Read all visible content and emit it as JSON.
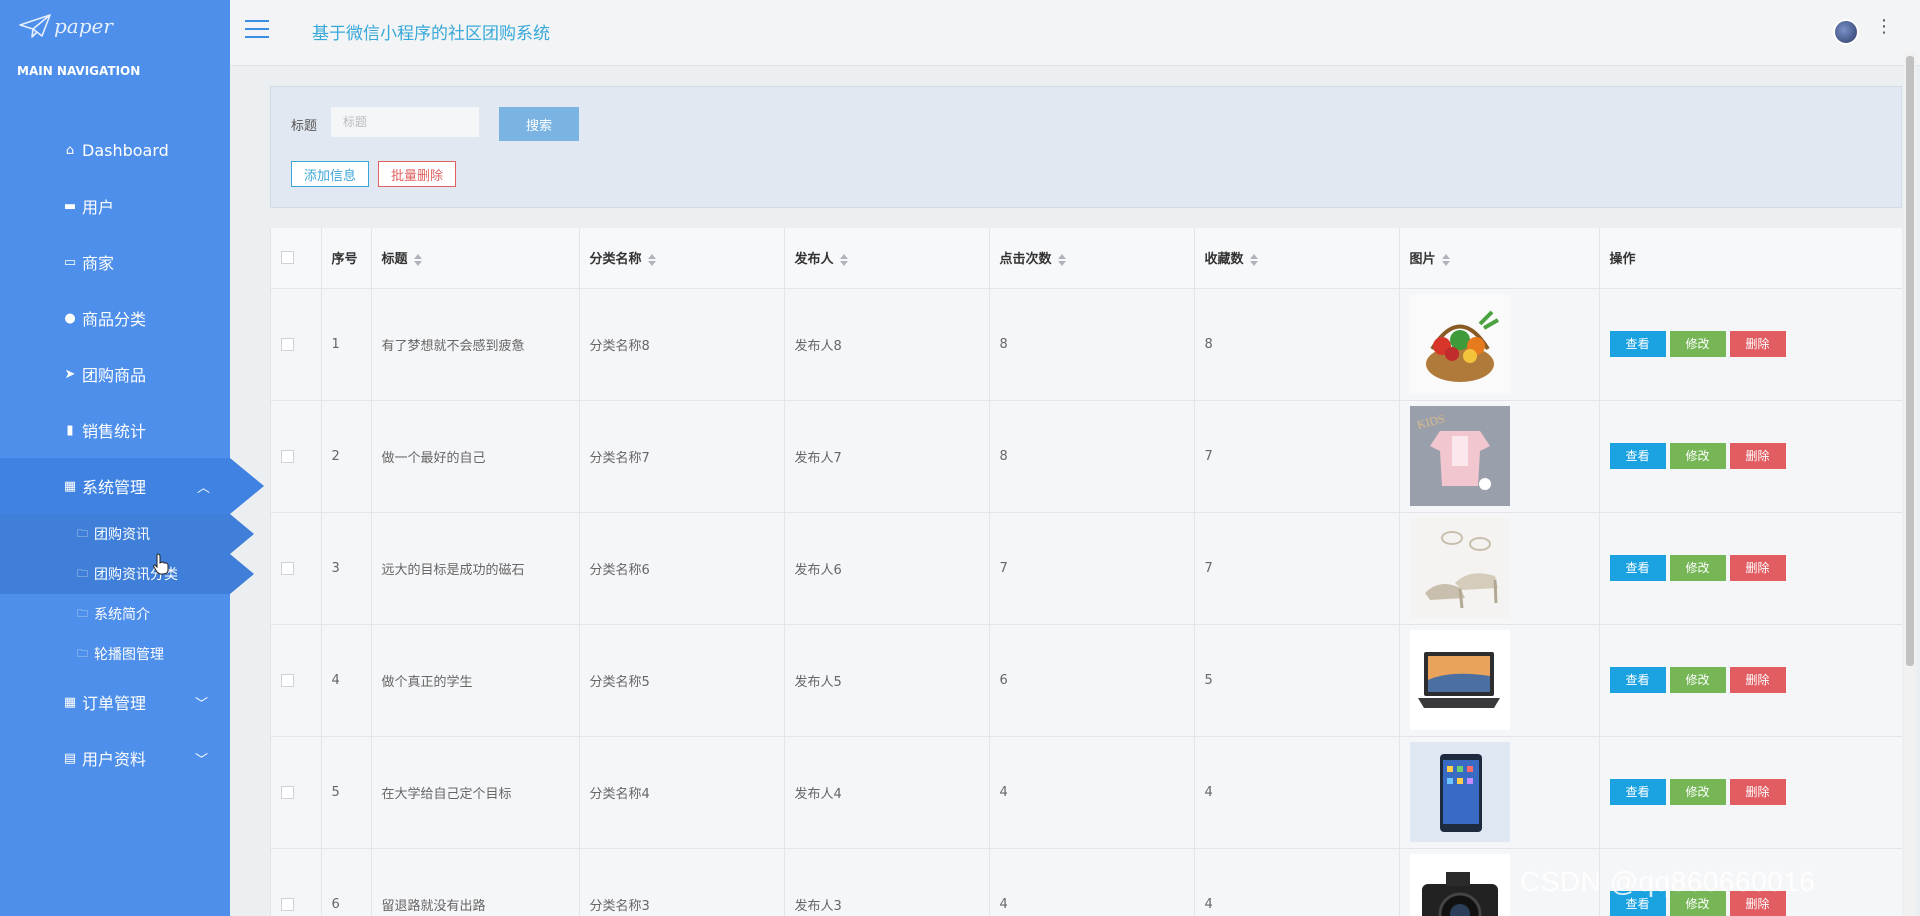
{
  "brand": {
    "logo_text": "paper"
  },
  "sidebar": {
    "section_title": "MAIN NAVIGATION",
    "items": [
      {
        "label": "Dashboard",
        "icon": "home-icon"
      },
      {
        "label": "用户",
        "icon": "briefcase-icon"
      },
      {
        "label": "商家",
        "icon": "id-card-icon"
      },
      {
        "label": "商品分类",
        "icon": "user-icon"
      },
      {
        "label": "团购商品",
        "icon": "paper-plane-icon"
      },
      {
        "label": "销售统计",
        "icon": "clipboard-icon"
      },
      {
        "label": "系统管理",
        "icon": "grid-icon",
        "expanded": true
      },
      {
        "label": "订单管理",
        "icon": "grid-icon"
      },
      {
        "label": "用户资料",
        "icon": "browser-icon"
      }
    ],
    "sub_items": [
      {
        "label": "团购资讯",
        "icon": "folder-icon"
      },
      {
        "label": "团购资讯分类",
        "icon": "folder-icon"
      },
      {
        "label": "系统简介",
        "icon": "folder-icon"
      },
      {
        "label": "轮播图管理",
        "icon": "folder-icon"
      }
    ]
  },
  "header": {
    "title": "基于微信小程序的社区团购系统"
  },
  "search": {
    "label": "标题",
    "placeholder": "标题",
    "button_label": "搜索",
    "add_label": "添加信息",
    "bulk_delete_label": "批量删除"
  },
  "table": {
    "columns": [
      "序号",
      "标题",
      "分类名称",
      "发布人",
      "点击次数",
      "收藏数",
      "图片",
      "操作"
    ],
    "actions": {
      "view": "查看",
      "edit": "修改",
      "delete": "删除"
    },
    "rows": [
      {
        "no": "1",
        "title": "有了梦想就不会感到疲惫",
        "category": "分类名称8",
        "publisher": "发布人8",
        "clicks": "8",
        "favorites": "8",
        "image": "vegetable-basket"
      },
      {
        "no": "2",
        "title": "做一个最好的自己",
        "category": "分类名称7",
        "publisher": "发布人7",
        "clicks": "8",
        "favorites": "7",
        "image": "baby-clothes"
      },
      {
        "no": "3",
        "title": "远大的目标是成功的磁石",
        "category": "分类名称6",
        "publisher": "发布人6",
        "clicks": "7",
        "favorites": "7",
        "image": "high-heels"
      },
      {
        "no": "4",
        "title": "做个真正的学生",
        "category": "分类名称5",
        "publisher": "发布人5",
        "clicks": "6",
        "favorites": "5",
        "image": "laptop"
      },
      {
        "no": "5",
        "title": "在大学给自己定个目标",
        "category": "分类名称4",
        "publisher": "发布人4",
        "clicks": "4",
        "favorites": "4",
        "image": "smartphone"
      },
      {
        "no": "6",
        "title": "留退路就没有出路",
        "category": "分类名称3",
        "publisher": "发布人3",
        "clicks": "4",
        "favorites": "4",
        "image": "camera"
      }
    ]
  },
  "watermark": "CSDN @qq860660016",
  "colors": {
    "sidebar": "#4d8fea",
    "accent": "#37a8d8",
    "view": "#1ba2e0",
    "edit": "#76b657",
    "delete": "#e15d62"
  }
}
